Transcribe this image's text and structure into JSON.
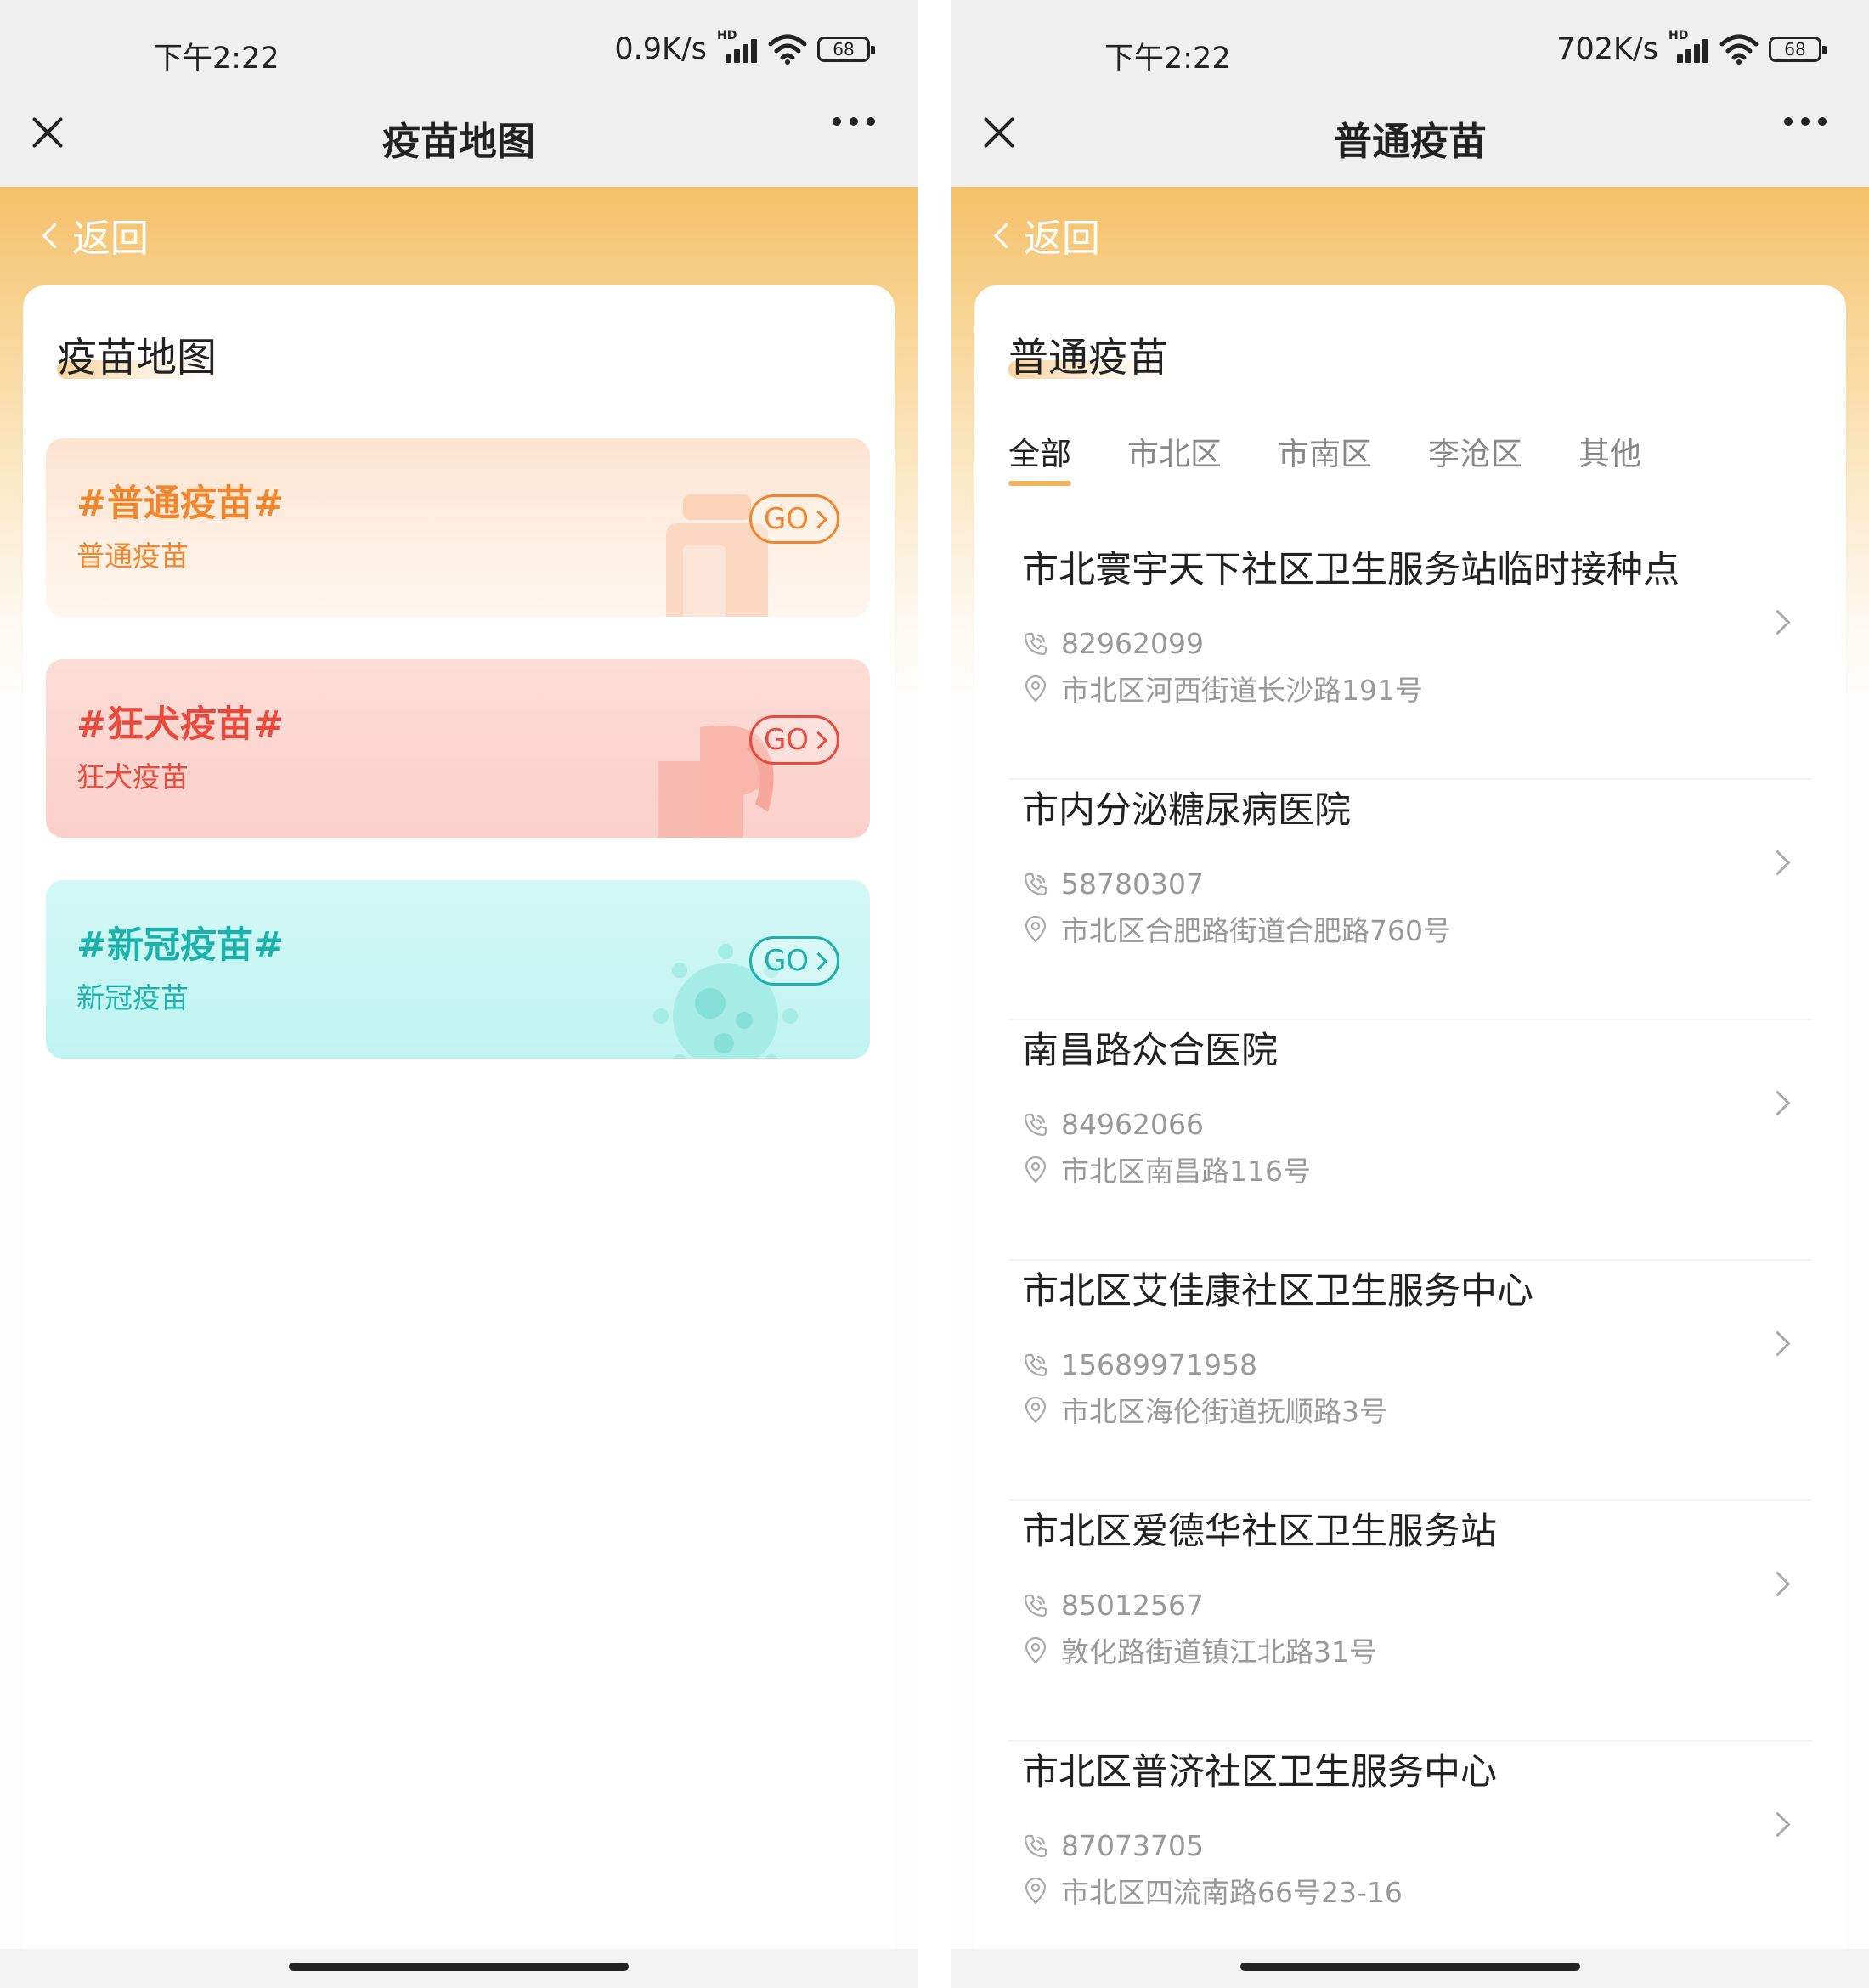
{
  "left": {
    "status": {
      "time": "下午2:22",
      "speed": "0.9K/s",
      "hd": "HD",
      "battery": "68"
    },
    "title": "疫苗地图",
    "back_label": "返回",
    "section_title": "疫苗地图",
    "go_label": "GO",
    "categories": [
      {
        "title": "#普通疫苗#",
        "subtitle": "普通疫苗",
        "color": "#f0862d"
      },
      {
        "title": "#狂犬疫苗#",
        "subtitle": "狂犬疫苗",
        "color": "#e84a3c"
      },
      {
        "title": "#新冠疫苗#",
        "subtitle": "新冠疫苗",
        "color": "#1bb2ac"
      }
    ]
  },
  "right": {
    "status": {
      "time": "下午2:22",
      "speed": "702K/s",
      "hd": "HD",
      "battery": "68"
    },
    "title": "普通疫苗",
    "back_label": "返回",
    "section_title": "普通疫苗",
    "tabs": [
      "全部",
      "市北区",
      "市南区",
      "李沧区",
      "其他"
    ],
    "active_tab": "全部",
    "locations": [
      {
        "name": "市北寰宇天下社区卫生服务站临时接种点",
        "phone": "82962099",
        "address": "市北区河西街道长沙路191号"
      },
      {
        "name": "市内分泌糖尿病医院",
        "phone": "58780307",
        "address": "市北区合肥路街道合肥路760号"
      },
      {
        "name": "南昌路众合医院",
        "phone": "84962066",
        "address": "市北区南昌路116号"
      },
      {
        "name": "市北区艾佳康社区卫生服务中心",
        "phone": "15689971958",
        "address": "市北区海伦街道抚顺路3号"
      },
      {
        "name": "市北区爱德华社区卫生服务站",
        "phone": "85012567",
        "address": "敦化路街道镇江北路31号"
      },
      {
        "name": "市北区普济社区卫生服务中心",
        "phone": "87073705",
        "address": "市北区四流南路66号23-16"
      }
    ]
  },
  "colors": {
    "accent": "#f3b55c",
    "banner": "#f5c069"
  },
  "icons": [
    "close-icon",
    "more-icon",
    "back-chevron-icon",
    "phone-icon",
    "location-pin-icon",
    "chevron-right-icon",
    "wifi-icon",
    "signal-icon",
    "battery-icon"
  ]
}
